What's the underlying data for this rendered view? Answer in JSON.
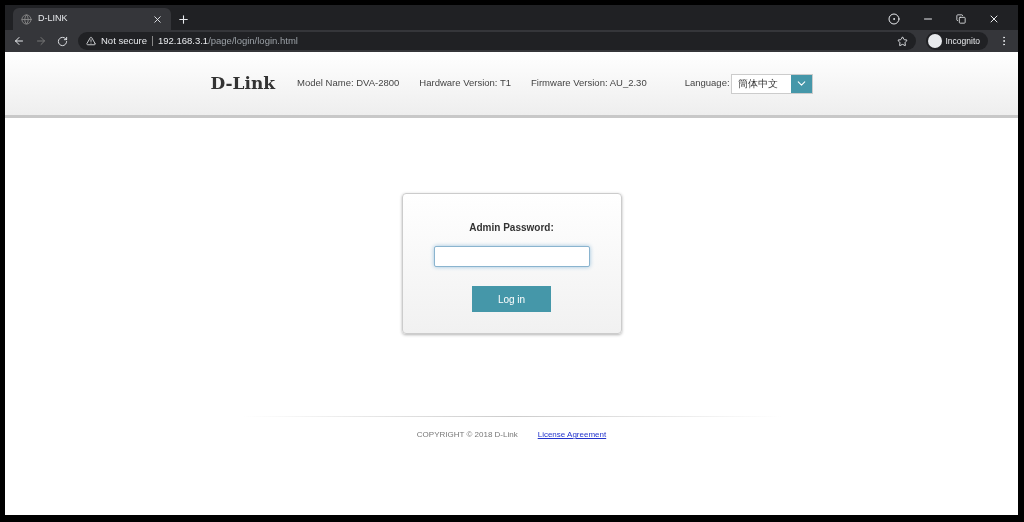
{
  "browser": {
    "tab": {
      "title": "D-LINK",
      "selected": true
    },
    "address": {
      "security": "Not secure",
      "host": "192.168.3.1",
      "path": "/page/login/login.html"
    },
    "profile": "Incognito"
  },
  "header": {
    "logo": "D-Link",
    "model": "Model Name: DVA-2800",
    "hardware": "Hardware Version: T1",
    "firmware": "Firmware Version: AU_2.30",
    "language_label": "Language:",
    "language_value": "簡体中文"
  },
  "login": {
    "label": "Admin Password:",
    "button": "Log in"
  },
  "footer": {
    "copyright": "COPYRIGHT © 2018 D-Link",
    "link": "License Agreement"
  }
}
